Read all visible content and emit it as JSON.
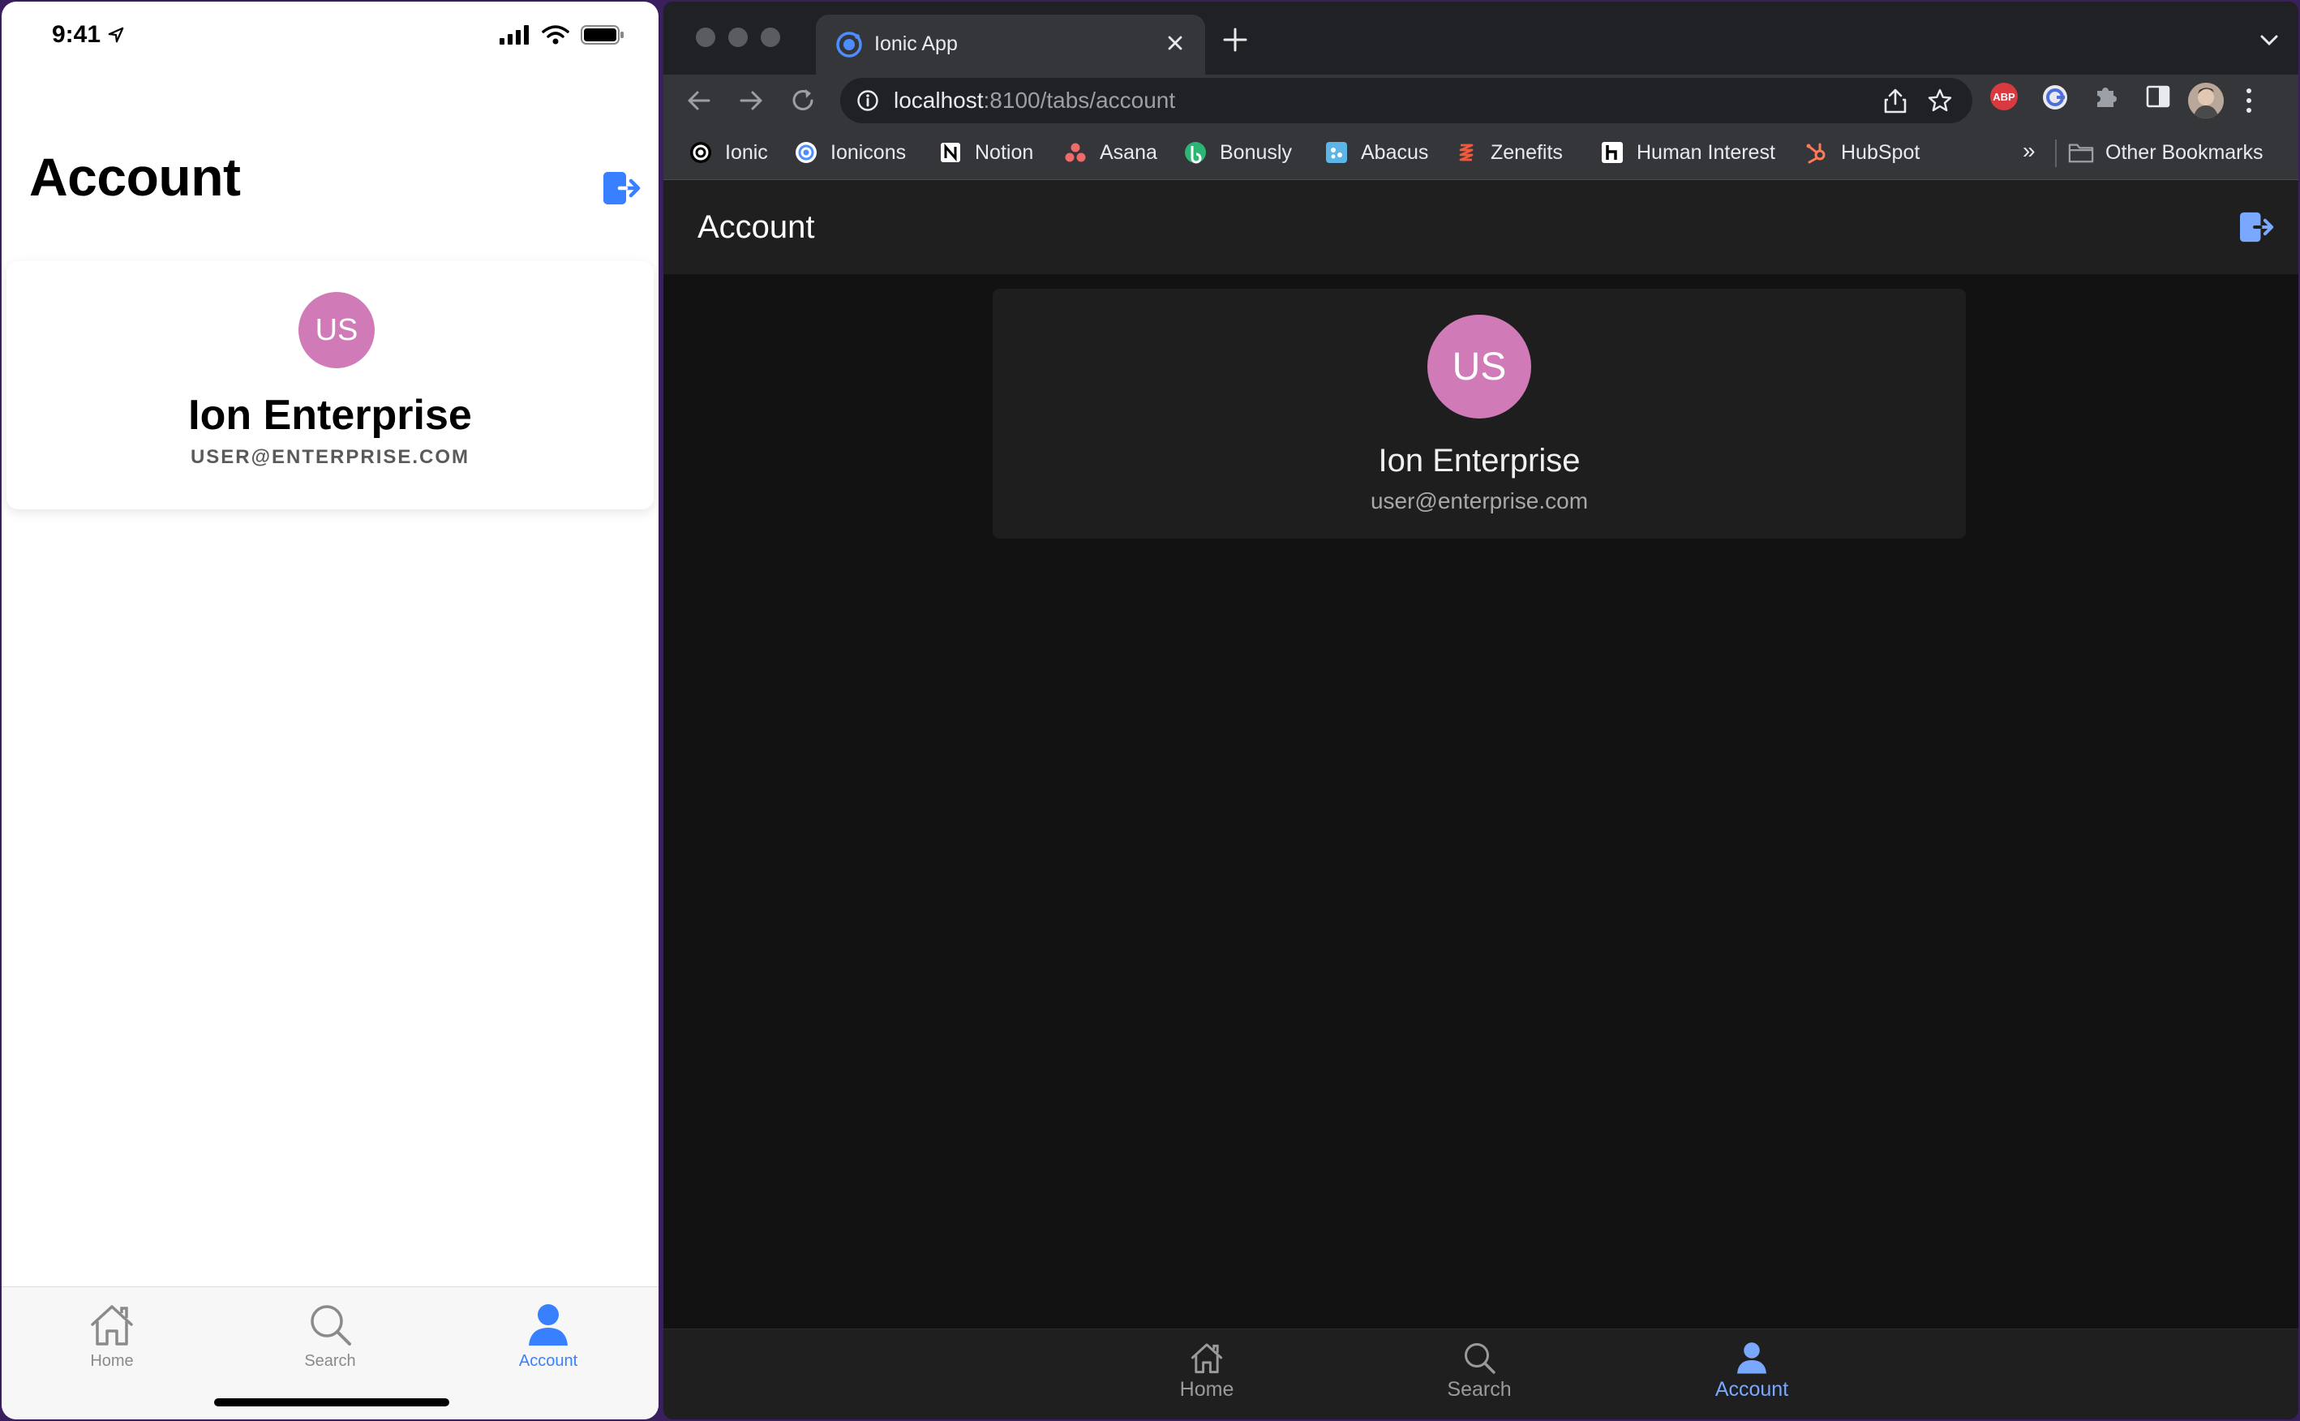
{
  "phone": {
    "status": {
      "time": "9:41"
    },
    "title": "Account",
    "profile": {
      "initials": "US",
      "name": "Ion Enterprise",
      "email": "USER@ENTERPRISE.COM"
    },
    "tabs": [
      {
        "label": "Home",
        "icon": "home-icon",
        "active": false
      },
      {
        "label": "Search",
        "icon": "search-icon",
        "active": false
      },
      {
        "label": "Account",
        "icon": "person-icon",
        "active": true
      }
    ]
  },
  "browser": {
    "tab": {
      "title": "Ionic App"
    },
    "address": {
      "host": "localhost",
      "path": ":8100/tabs/account"
    },
    "extensions": {
      "abp_label": "ABP"
    },
    "bookmarks": [
      {
        "label": "Ionic",
        "icon": "ionic-icon"
      },
      {
        "label": "Ionicons",
        "icon": "ionicons-icon"
      },
      {
        "label": "Notion",
        "icon": "notion-icon"
      },
      {
        "label": "Asana",
        "icon": "asana-icon"
      },
      {
        "label": "Bonusly",
        "icon": "bonusly-icon"
      },
      {
        "label": "Abacus",
        "icon": "abacus-icon"
      },
      {
        "label": "Zenefits",
        "icon": "zenefits-icon"
      },
      {
        "label": "Human Interest",
        "icon": "human-interest-icon"
      },
      {
        "label": "HubSpot",
        "icon": "hubspot-icon"
      }
    ],
    "bookmarks_more": "»",
    "other_bookmarks": "Other Bookmarks",
    "app": {
      "title": "Account",
      "profile": {
        "initials": "US",
        "name": "Ion Enterprise",
        "email": "user@enterprise.com"
      },
      "tabs": [
        {
          "label": "Home",
          "icon": "home-icon",
          "active": false
        },
        {
          "label": "Search",
          "icon": "search-icon",
          "active": false
        },
        {
          "label": "Account",
          "icon": "person-icon",
          "active": true
        }
      ]
    }
  },
  "colors": {
    "accent": "#3880ff",
    "accent_dark": "#7aa8ff",
    "avatar": "#d07ab7"
  }
}
